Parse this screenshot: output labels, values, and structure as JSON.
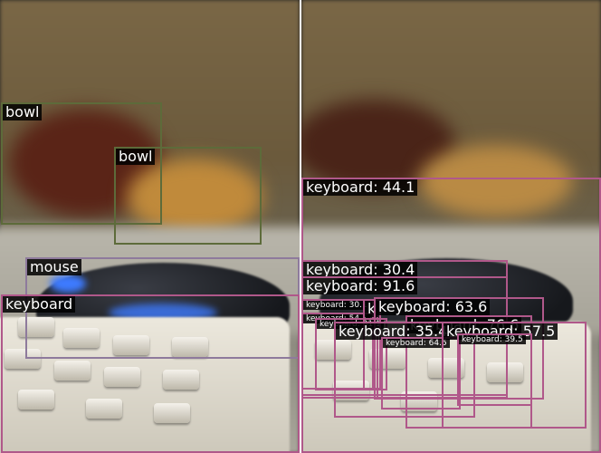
{
  "colors": {
    "bowl_box": "#5d6b3a",
    "mouse_box": "#8e7a9c",
    "keyboard_box": "#b0588a",
    "label_background": "#000000",
    "label_text": "#ffffff"
  },
  "left_panel": {
    "labels": {
      "bowl_1": "bowl",
      "bowl_2": "bowl",
      "mouse": "mouse",
      "keyboard": "keyboard"
    }
  },
  "right_panel": {
    "labels": {
      "kb_44_1": "keyboard: 44.1",
      "kb_30_4": "keyboard: 30.4",
      "kb_91_6": "keyboard: 91.6",
      "kb_63_6": "keyboard: 63.6",
      "kb_76_6": "keyboard: 76.6",
      "kb_35_4": "keyboard: 35.4",
      "kb_57_5": "keyboard: 57.5",
      "kb_30_1": "keyboard: 30.1",
      "kb_54_1": "keyboard: 54.1",
      "kb_partial_a": "keyboard: 31.1",
      "kb_partial_b": "k",
      "kb_64_5": "keyboard: 64.5",
      "kb_39_5": "keyboard: 39.5"
    }
  }
}
